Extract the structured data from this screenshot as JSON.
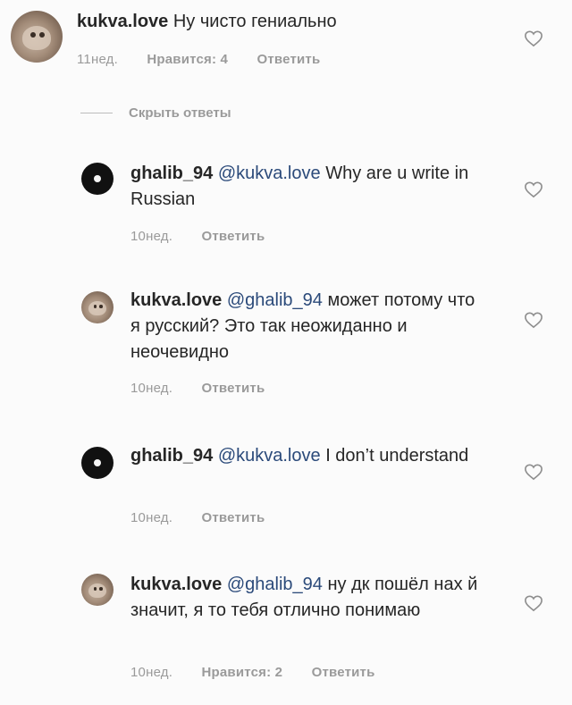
{
  "comments": [
    {
      "username": "kukva.love",
      "mention": "",
      "text": "Ну чисто гениально",
      "time": "11нед.",
      "likes": "Нравится: 4",
      "reply": "Ответить"
    },
    {
      "username": "ghalib_94",
      "mention": "@kukva.love",
      "text": "Why are u write in Russian",
      "time": "10нед.",
      "likes": "",
      "reply": "Ответить"
    },
    {
      "username": "kukva.love",
      "mention": "@ghalib_94",
      "text": "может потому что я русский? Это так неожиданно и неочевидно",
      "time": "10нед.",
      "likes": "",
      "reply": "Ответить"
    },
    {
      "username": "ghalib_94",
      "mention": "@kukva.love",
      "text": "I don’t understand",
      "time": "10нед.",
      "likes": "",
      "reply": "Ответить"
    },
    {
      "username": "kukva.love",
      "mention": "@ghalib_94",
      "text": "ну дк пошёл нах  й значит, я то тебя отлично понимаю",
      "time": "10нед.",
      "likes": "Нравится: 2",
      "reply": "Ответить"
    }
  ],
  "hide_replies_label": "Скрыть ответы",
  "icons": {
    "like": "heart-outline-icon"
  },
  "colors": {
    "meta_gray": "#9a9a9a",
    "text": "#262626",
    "mention": "#2b4a7a"
  }
}
